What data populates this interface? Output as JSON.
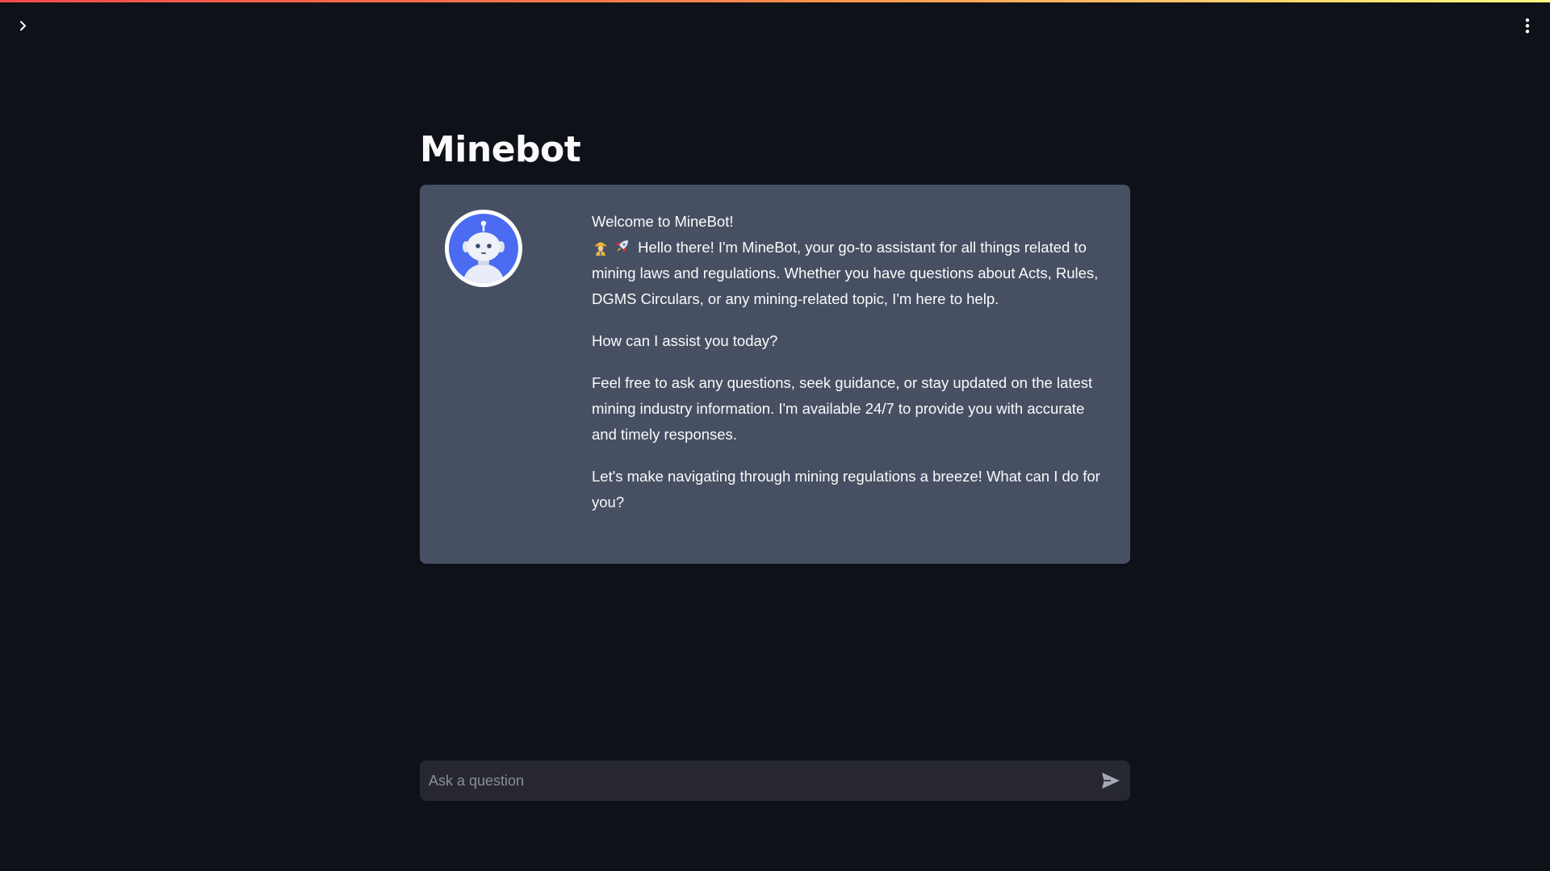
{
  "app": {
    "title": "Minebot"
  },
  "chat": {
    "messages": [
      {
        "role": "assistant",
        "avatar": "robot-icon",
        "greeting": "Welcome to MineBot!",
        "intro": "Hello there! I'm MineBot, your go-to assistant for all things related to mining laws and regulations. Whether you have questions about Acts, Rules, DGMS Circulars, or any mining-related topic, I'm here to help.",
        "question": "How can I assist you today?",
        "body": "Feel free to ask any questions, seek guidance, or stay updated on the latest mining industry information. I'm available 24/7 to provide you with accurate and timely responses.",
        "closing": "Let's make navigating through mining regulations a breeze! What can I do for you?",
        "emojis": [
          "miner-emoji",
          "rocket-emoji"
        ]
      }
    ]
  },
  "input": {
    "placeholder": "Ask a question",
    "value": ""
  },
  "colors": {
    "background": "#0e1117",
    "message_bg": "#475063",
    "input_bg": "#262730",
    "avatar_blue": "#4b6cf0",
    "accent_gradient_start": "#ff4b4b",
    "accent_gradient_end": "#fffd80"
  }
}
